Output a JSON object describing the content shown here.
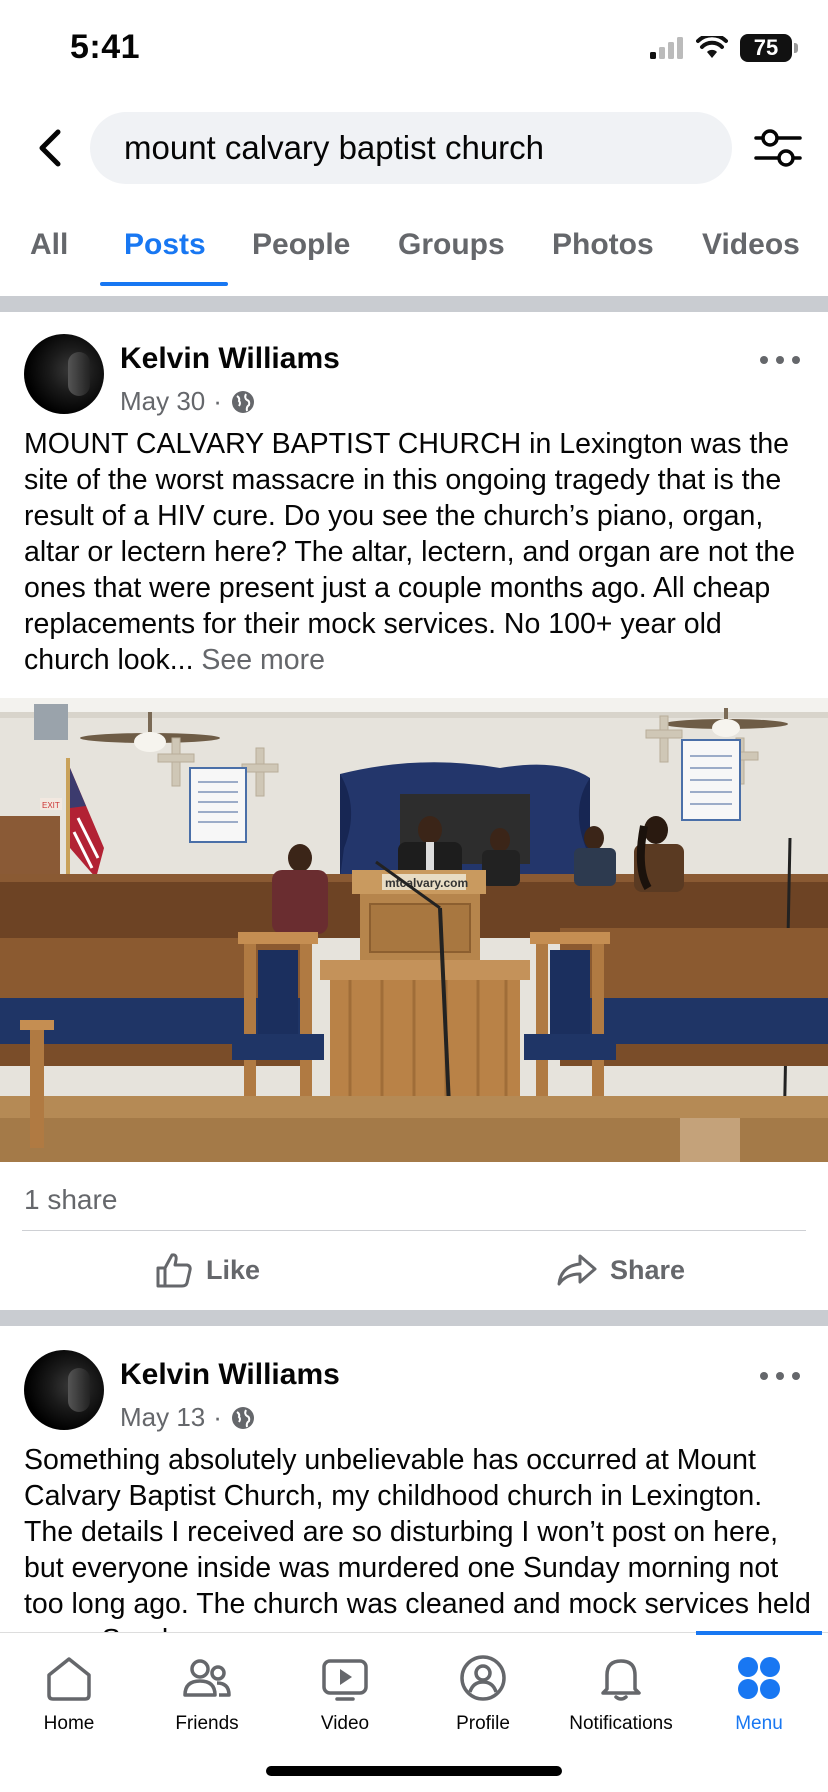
{
  "status_bar": {
    "time": "5:41",
    "battery": "75"
  },
  "search": {
    "query": "mount calvary baptist church"
  },
  "tabs": [
    {
      "label": "All"
    },
    {
      "label": "Posts"
    },
    {
      "label": "People"
    },
    {
      "label": "Groups"
    },
    {
      "label": "Photos"
    },
    {
      "label": "Videos"
    }
  ],
  "active_tab": "Posts",
  "posts": [
    {
      "author": "Kelvin Williams",
      "date": "May 30",
      "audience_icon": "globe-icon",
      "text": "MOUNT CALVARY BAPTIST CHURCH in Lexington was the site of the worst massacre in this ongoing tragedy that is the result of a HIV cure. Do you see the church’s piano, organ, altar or lectern here? The altar, lectern, and organ are not the ones that were present just a couple months ago. All cheap replacements for their mock services. No 100+ year old church look...",
      "see_more": "See more",
      "image_text": "mtcalvary.com",
      "shares": "1 share",
      "like_label": "Like",
      "share_label": "Share"
    },
    {
      "author": "Kelvin Williams",
      "date": "May 13",
      "audience_icon": "globe-icon",
      "text": "Something absolutely unbelievable has occurred at Mount Calvary Baptist Church, my childhood church in Lexington. The details I received are so disturbing I won’t post on here, but everyone inside was murdered one Sunday morning not too long ago. The church was cleaned and mock services held every Sunday..."
    }
  ],
  "bottom_nav": [
    {
      "label": "Home",
      "icon": "home-icon"
    },
    {
      "label": "Friends",
      "icon": "friends-icon"
    },
    {
      "label": "Video",
      "icon": "video-icon"
    },
    {
      "label": "Profile",
      "icon": "profile-icon"
    },
    {
      "label": "Notifications",
      "icon": "bell-icon"
    },
    {
      "label": "Menu",
      "icon": "menu-grid-icon"
    }
  ],
  "active_nav": "Menu",
  "colors": {
    "accent": "#1877f2",
    "secondary_text": "#65676b",
    "divider": "#c9ccd1"
  }
}
